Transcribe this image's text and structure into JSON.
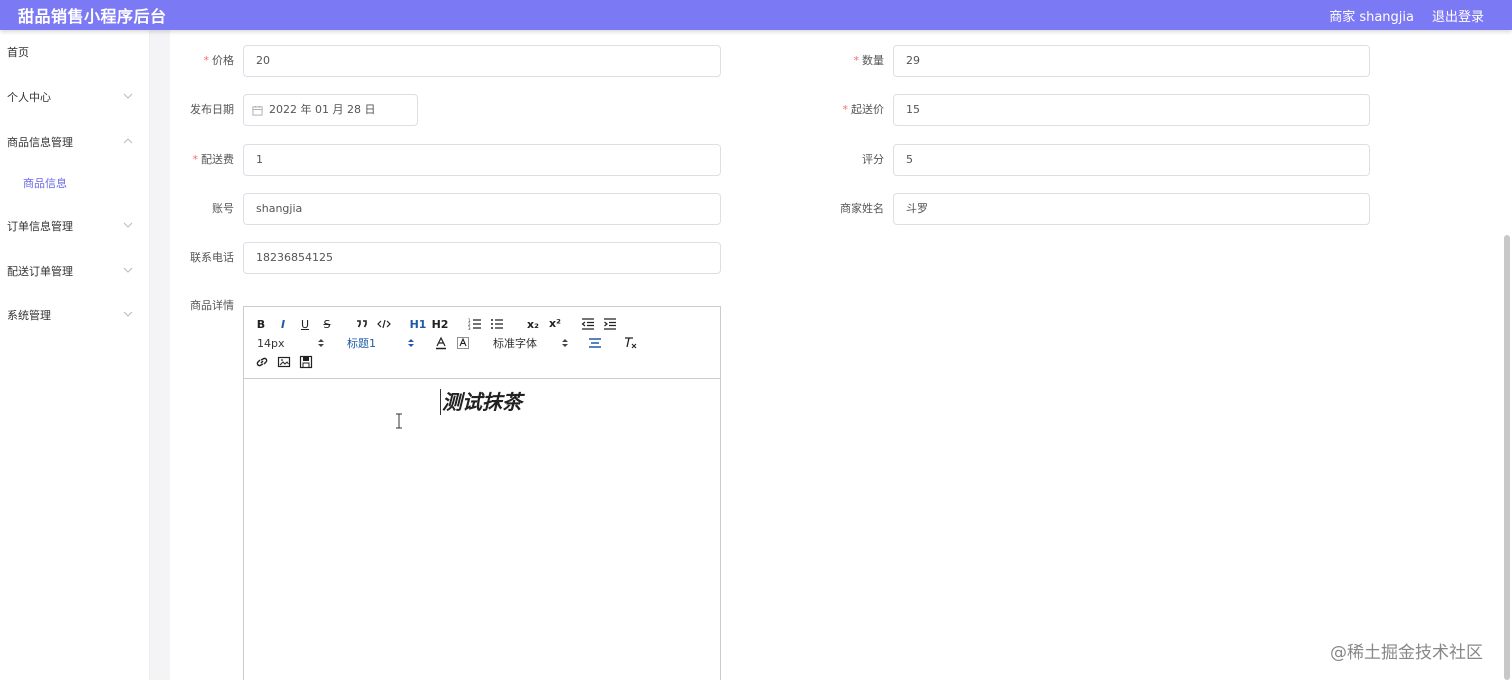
{
  "header": {
    "title": "甜品销售小程序后台",
    "user_label": "商家 shangjia",
    "logout_label": "退出登录"
  },
  "sidebar": {
    "items": [
      {
        "label": "首页"
      },
      {
        "label": "个人中心"
      },
      {
        "label": "商品信息管理"
      },
      {
        "label": "商品信息"
      },
      {
        "label": "订单信息管理"
      },
      {
        "label": "配送订单管理"
      },
      {
        "label": "系统管理"
      }
    ]
  },
  "form": {
    "price": {
      "label": "价格",
      "value": "20"
    },
    "quantity": {
      "label": "数量",
      "value": "29"
    },
    "publish_date": {
      "label": "发布日期",
      "value": "2022 年 01 月 28 日"
    },
    "min_order": {
      "label": "起送价",
      "value": "15"
    },
    "delivery_fee": {
      "label": "配送费",
      "value": "1"
    },
    "rating": {
      "label": "评分",
      "value": "5"
    },
    "account": {
      "label": "账号",
      "value": "shangjia"
    },
    "merchant_name": {
      "label": "商家姓名",
      "value": "斗罗"
    },
    "phone": {
      "label": "联系电话",
      "value": "18236854125"
    },
    "detail": {
      "label": "商品详情"
    }
  },
  "editor": {
    "bold": "B",
    "italic": "I",
    "underline": "U",
    "strike": "S",
    "h1": "H1",
    "h2": "H2",
    "sub": "x₂",
    "sup": "x²",
    "font_size": "14px",
    "heading": "标题1",
    "font_family": "标准字体",
    "content": "测试抹茶"
  },
  "watermark": "@稀土掘金技术社区",
  "colors": {
    "header_bg": "#7c79f5",
    "active_menu": "#6b68e8",
    "required": "#f56c6c",
    "toolbar_blue": "#1f5ba8"
  }
}
